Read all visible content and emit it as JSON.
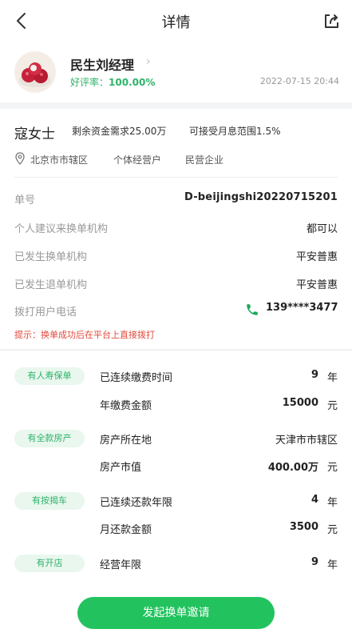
{
  "header": {
    "title": "详情"
  },
  "manager": {
    "name": "民生刘经理",
    "rating_label": "好评率：",
    "rating_value": "100.00%",
    "timestamp": "2022-07-15 20:44"
  },
  "customer": {
    "name": "寇女士",
    "funding_need": "剩余资金需求25.00万",
    "rate_range": "可接受月息范围1.5%",
    "tags": [
      "北京市市辖区",
      "个体经营户",
      "民营企业"
    ]
  },
  "info_rows": [
    {
      "label": "单号",
      "value": "D-beijingshi20220715201"
    },
    {
      "label": "个人建议来换单机构",
      "value": "都可以"
    },
    {
      "label": "已发生换单机构",
      "value": "平安普惠"
    },
    {
      "label": "已发生退单机构",
      "value": "平安普惠"
    }
  ],
  "phone": {
    "label": "拨打用户电话",
    "number": "139****3477"
  },
  "hint": "提示：换单成功后在平台上直接拨打",
  "assets": [
    {
      "badge": "有人寿保单",
      "rows": [
        {
          "label": "已连续缴费时间",
          "value": "9",
          "unit": "年"
        },
        {
          "label": "年缴费金额",
          "value": "15000",
          "unit": "元"
        }
      ]
    },
    {
      "badge": "有全款房产",
      "rows": [
        {
          "label": "房产所在地",
          "value": "天津市市辖区",
          "unit": ""
        },
        {
          "label": "房产市值",
          "value": "400.00万",
          "unit": "元"
        }
      ]
    },
    {
      "badge": "有按揭车",
      "rows": [
        {
          "label": "已连续还款年限",
          "value": "4",
          "unit": "年"
        },
        {
          "label": "月还款金额",
          "value": "3500",
          "unit": "元"
        }
      ]
    },
    {
      "badge": "有开店",
      "rows": [
        {
          "label": "经营年限",
          "value": "9",
          "unit": "年"
        }
      ]
    }
  ],
  "cta_label": "发起换单邀请",
  "colors": {
    "accent_green": "#22c35e",
    "rating_green": "#2eb36a",
    "hint_red": "#e2493c"
  }
}
